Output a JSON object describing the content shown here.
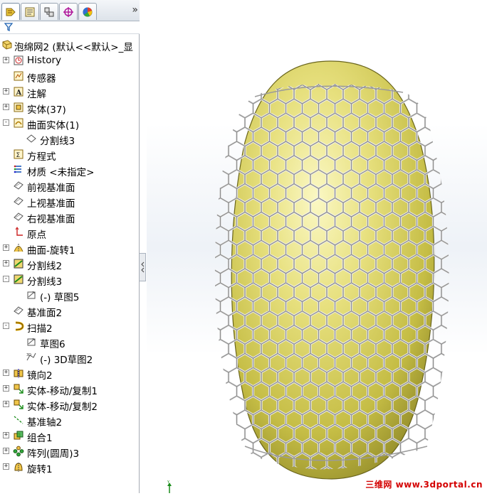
{
  "feature_manager": {
    "collapse_label": "»",
    "tabs": [
      {
        "icon": "feature-tree-icon"
      },
      {
        "icon": "property-manager-icon"
      },
      {
        "icon": "configuration-manager-icon"
      },
      {
        "icon": "dimxpert-icon"
      },
      {
        "icon": "display-manager-icon"
      }
    ],
    "filter_icon": "filter-icon",
    "root": {
      "label": "泡绵网2 (默认<<默认>_显"
    },
    "items": [
      {
        "label": "History",
        "icon": "history-icon",
        "expander": "+"
      },
      {
        "label": "传感器",
        "icon": "sensor-icon",
        "expander": ""
      },
      {
        "label": "注解",
        "icon": "annotation-icon",
        "expander": "+"
      },
      {
        "label": "实体(37)",
        "icon": "solid-bodies-icon",
        "expander": "+"
      },
      {
        "label": "曲面实体(1)",
        "icon": "surface-bodies-icon",
        "expander": "-"
      },
      {
        "label": "分割线3",
        "icon": "split-line-body-icon",
        "expander": ""
      },
      {
        "label": "方程式",
        "icon": "equations-icon",
        "expander": ""
      },
      {
        "label": "材质 <未指定>",
        "icon": "material-icon",
        "expander": ""
      },
      {
        "label": "前视基准面",
        "icon": "plane-icon",
        "expander": ""
      },
      {
        "label": "上视基准面",
        "icon": "plane-icon",
        "expander": ""
      },
      {
        "label": "右视基准面",
        "icon": "plane-icon",
        "expander": ""
      },
      {
        "label": "原点",
        "icon": "origin-icon",
        "expander": ""
      },
      {
        "label": "曲面-旋转1",
        "icon": "surface-revolve-icon",
        "expander": "+"
      },
      {
        "label": "分割线2",
        "icon": "split-line-icon",
        "expander": "+"
      },
      {
        "label": "分割线3",
        "icon": "split-line-icon",
        "expander": "-"
      },
      {
        "label": "(-) 草图5",
        "icon": "sketch-icon",
        "expander": ""
      },
      {
        "label": "基准面2",
        "icon": "plane-icon",
        "expander": ""
      },
      {
        "label": "扫描2",
        "icon": "sweep-icon",
        "expander": "-"
      },
      {
        "label": "草图6",
        "icon": "sketch-icon",
        "expander": ""
      },
      {
        "label": "(-) 3D草图2",
        "icon": "3d-sketch-icon",
        "expander": ""
      },
      {
        "label": "镜向2",
        "icon": "mirror-icon",
        "expander": "+"
      },
      {
        "label": "实体-移动/复制1",
        "icon": "move-copy-icon",
        "expander": "+"
      },
      {
        "label": "实体-移动/复制2",
        "icon": "move-copy-icon",
        "expander": "+"
      },
      {
        "label": "基准轴2",
        "icon": "axis-icon",
        "expander": ""
      },
      {
        "label": "组合1",
        "icon": "combine-icon",
        "expander": "+"
      },
      {
        "label": "阵列(圆周)3",
        "icon": "circular-pattern-icon",
        "expander": "+"
      },
      {
        "label": "旋转1",
        "icon": "revolve-icon",
        "expander": "+"
      }
    ]
  },
  "viewport": {
    "model": "egg-shaped surface wrapped in hexagonal mesh net",
    "egg_color": "#d9d264",
    "mesh_color": "#b8b8b8",
    "triad_label": "Y",
    "watermark": "三维网 www.3dportal.cn"
  },
  "colors": {
    "accent": "#2f6fb8",
    "panel_border": "#a6acb5",
    "watermark": "#d40000"
  }
}
